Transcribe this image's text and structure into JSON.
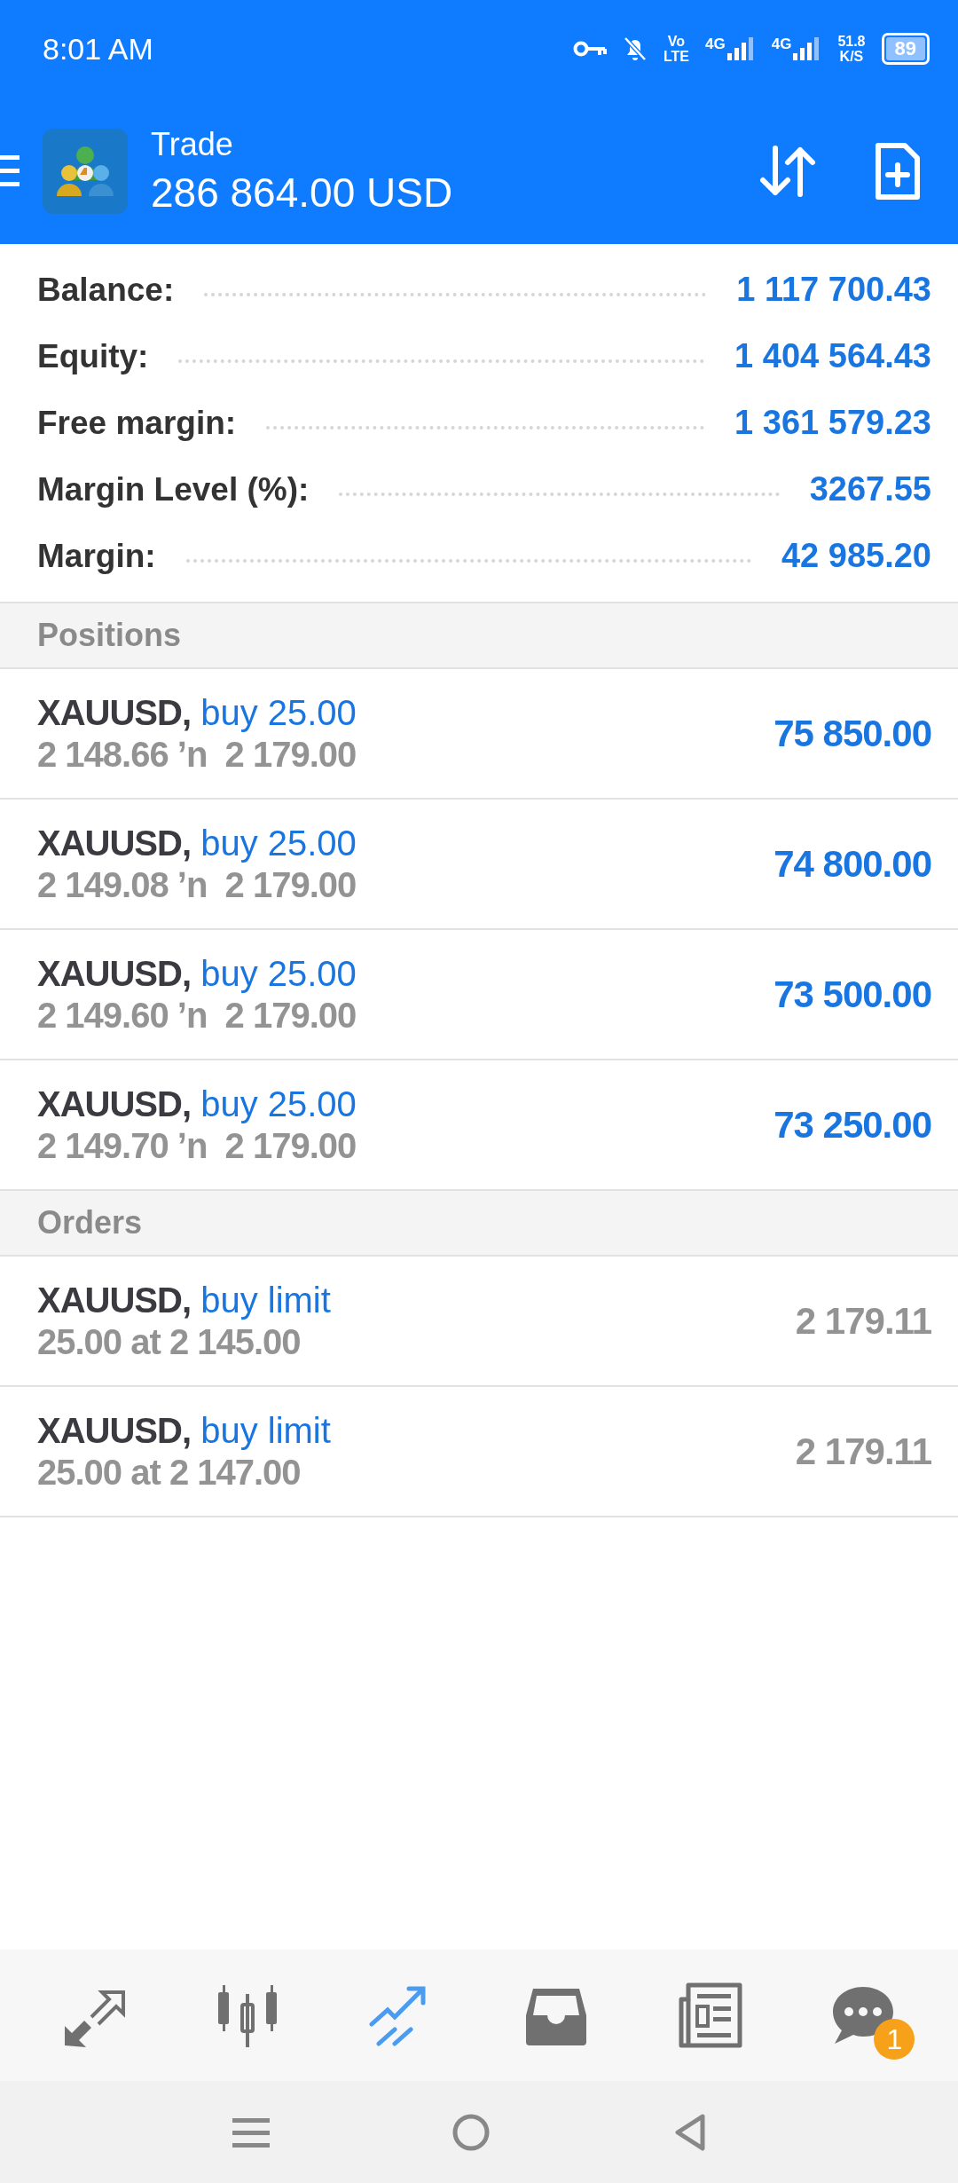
{
  "status_bar": {
    "time": "8:01 AM",
    "volte": [
      "Vo",
      "LTE"
    ],
    "networks": [
      {
        "label": "4G"
      },
      {
        "label": "4G"
      }
    ],
    "speed": [
      "51.8",
      "K/S"
    ],
    "battery": "89"
  },
  "header": {
    "title": "Trade",
    "amount": "286 864.00 USD"
  },
  "summary": [
    {
      "label": "Balance:",
      "value": "1 117 700.43"
    },
    {
      "label": "Equity:",
      "value": "1 404 564.43"
    },
    {
      "label": "Free margin:",
      "value": "1 361 579.23"
    },
    {
      "label": "Margin Level (%):",
      "value": "3267.55"
    },
    {
      "label": "Margin:",
      "value": "42 985.20"
    }
  ],
  "sections": [
    {
      "title": "Positions",
      "kind": "positions",
      "items": [
        {
          "symbol": "XAUUSD,",
          "side": "buy 25.00",
          "detail": "2 148.66 ʼn  2 179.00",
          "value": "75 850.00"
        },
        {
          "symbol": "XAUUSD,",
          "side": "buy 25.00",
          "detail": "2 149.08 ʼn  2 179.00",
          "value": "74 800.00"
        },
        {
          "symbol": "XAUUSD,",
          "side": "buy 25.00",
          "detail": "2 149.60 ʼn  2 179.00",
          "value": "73 500.00"
        },
        {
          "symbol": "XAUUSD,",
          "side": "buy 25.00",
          "detail": "2 149.70 ʼn  2 179.00",
          "value": "73 250.00"
        }
      ]
    },
    {
      "title": "Orders",
      "kind": "orders",
      "items": [
        {
          "symbol": "XAUUSD,",
          "side": "buy limit",
          "detail": "25.00 at 2 145.00",
          "value": "2 179.11"
        },
        {
          "symbol": "XAUUSD,",
          "side": "buy limit",
          "detail": "25.00 at 2 147.00",
          "value": "2 179.11"
        }
      ]
    }
  ],
  "bottom_nav": [
    {
      "kind": "quotes",
      "selected": false
    },
    {
      "kind": "chart",
      "selected": false
    },
    {
      "kind": "trade",
      "selected": true
    },
    {
      "kind": "mailbox",
      "selected": false
    },
    {
      "kind": "news",
      "selected": false
    },
    {
      "kind": "chat",
      "selected": false,
      "badge": "1"
    }
  ]
}
